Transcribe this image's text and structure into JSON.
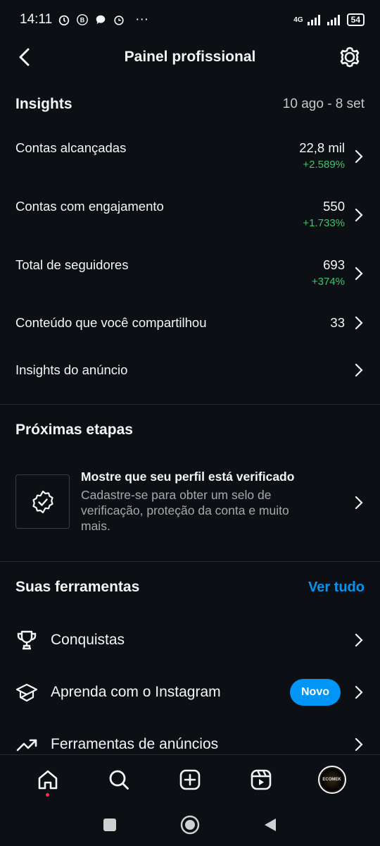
{
  "status_bar": {
    "time": "14:11",
    "network": "4G",
    "battery": "54",
    "more": "···"
  },
  "header": {
    "title": "Painel profissional"
  },
  "insights": {
    "title": "Insights",
    "date_range": "10 ago - 8 set",
    "rows": [
      {
        "label": "Contas alcançadas",
        "value": "22,8 mil",
        "delta": "+2.589%"
      },
      {
        "label": "Contas com engajamento",
        "value": "550",
        "delta": "+1.733%"
      },
      {
        "label": "Total de seguidores",
        "value": "693",
        "delta": "+374%"
      },
      {
        "label": "Conteúdo que você compartilhou",
        "value": "33",
        "delta": ""
      },
      {
        "label": "Insights do anúncio",
        "value": "",
        "delta": ""
      }
    ]
  },
  "next_steps": {
    "title": "Próximas etapas",
    "card": {
      "title": "Mostre que seu perfil está verificado",
      "description": "Cadastre-se para obter um selo de verificação, proteção da conta e muito mais."
    }
  },
  "tools": {
    "title": "Suas ferramentas",
    "see_all": "Ver tudo",
    "items": [
      {
        "label": "Conquistas",
        "icon": "trophy-icon",
        "badge": ""
      },
      {
        "label": "Aprenda com o Instagram",
        "icon": "graduation-cap-icon",
        "badge": "Novo"
      },
      {
        "label": "Ferramentas de anúncios",
        "icon": "trending-up-icon",
        "badge": ""
      }
    ]
  },
  "bottom_nav": [
    "home-icon",
    "search-icon",
    "create-icon",
    "reels-icon",
    "profile-avatar"
  ],
  "avatar_text": "ECOMEK",
  "colors": {
    "background": "#0c1014",
    "accent": "#0095f6",
    "positive": "#3ec46b"
  }
}
